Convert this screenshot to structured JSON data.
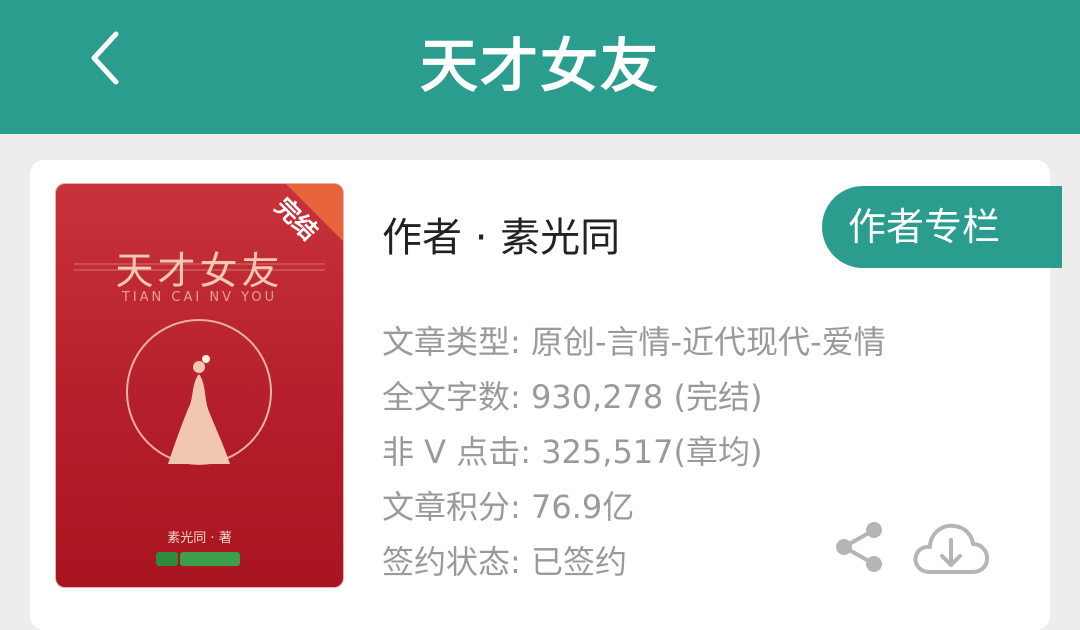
{
  "header": {
    "title": "天才女友",
    "back_icon": "chevron-left-icon"
  },
  "cover": {
    "title": "天才女友",
    "subtitle": "TIAN CAI NV YOU",
    "author_line": "素光同 · 著",
    "status_ribbon": "完结"
  },
  "author": {
    "label": "作者 · 素光同",
    "column_button": "作者专栏"
  },
  "info": {
    "type": "文章类型: 原创-言情-近代现代-爱情",
    "word_count": "全文字数: 930,278 (完结)",
    "clicks": "非 V 点击: 325,517(章均)",
    "score": "文章积分: 76.9亿",
    "sign_status": "签约状态:  已签约"
  },
  "actions": {
    "share_icon": "share-icon",
    "download_icon": "cloud-download-icon"
  },
  "colors": {
    "accent": "#2a9d8f",
    "cover_red": "#b51f2b",
    "ribbon": "#e8643c"
  }
}
